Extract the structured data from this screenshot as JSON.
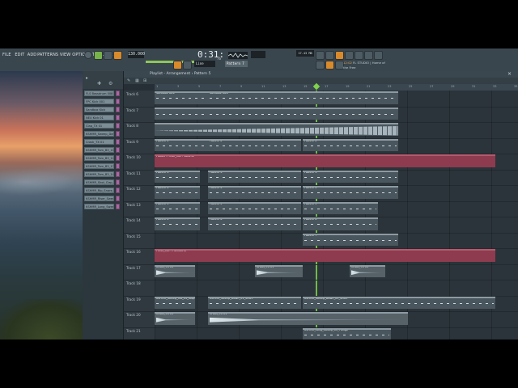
{
  "menu": [
    "FILE",
    "EDIT",
    "ADD",
    "PATTERNS",
    "VIEW",
    "OPTIONS",
    "TOOLS",
    "HELP"
  ],
  "transport": {
    "tempo": "130.000",
    "time": "0:31:",
    "time_small": "76",
    "pattern": "Pattern 7",
    "snap": "Line",
    "cpu": "17.43 MB"
  },
  "hint": {
    "line1": "12:02",
    "line2": "FL STUDIO | Home of",
    "line3": "the Free"
  },
  "playlist": {
    "title": "Playlist - Arrangement › Pattern 5"
  },
  "ruler": [
    "1",
    "3",
    "5",
    "7",
    "9",
    "11",
    "13",
    "15",
    "17",
    "19",
    "21",
    "23",
    "25",
    "27",
    "29",
    "31",
    "33",
    "35"
  ],
  "channels": [
    "FLS Bassdrum 008",
    "FPC Kick 001",
    "Sandbox Kick",
    "NEU Kick 01",
    "Clap_TX 01",
    "KSHMR_Sweep_Down",
    "Crash_TX 01",
    "KSHMR_Tom_B3_11",
    "KSHMR_Tom_B3_12",
    "KSHMR_Tom_B3_13",
    "KSHMR_Tom_B3_14",
    "KSHMR_Shot_Clap_B",
    "KSHMR_Rip_Snare_03",
    "KSHMR_Riser_Sweep",
    "KSHMR_Long_Sweep"
  ],
  "tracks": [
    "Track 6",
    "Track 7",
    "Track 8",
    "Track 9",
    "Track 10",
    "Track 11",
    "Track 12",
    "Track 13",
    "Track 14",
    "Track 15",
    "Track 16",
    "Track 17",
    "Track 18",
    "Track 19",
    "Track 20",
    "Track 21"
  ],
  "clips": [
    {
      "track": 0,
      "start": 0,
      "len": 66,
      "title": "Sandbox Kick",
      "kind": "pattern"
    },
    {
      "track": 0,
      "start": 66,
      "len": 235,
      "title": "Sandbox Kick",
      "kind": "pattern"
    },
    {
      "track": 1,
      "start": 0,
      "len": 66,
      "title": "",
      "kind": "pattern"
    },
    {
      "track": 1,
      "start": 66,
      "len": 235,
      "title": "",
      "kind": "pattern"
    },
    {
      "track": 2,
      "start": 0,
      "len": 301,
      "title": "",
      "kind": "beats"
    },
    {
      "track": 3,
      "start": 0,
      "len": 66,
      "title": "Pattern 2",
      "kind": "pattern"
    },
    {
      "track": 3,
      "start": 66,
      "len": 115,
      "title": "Pattern 2",
      "kind": "pattern"
    },
    {
      "track": 3,
      "start": 183,
      "len": 118,
      "title": "Pattern 2",
      "kind": "pattern"
    },
    {
      "track": 4,
      "start": 0,
      "len": 421,
      "title": "Fusion - Fresh_Cut - Volume",
      "kind": "auto"
    },
    {
      "track": 5,
      "start": 0,
      "len": 56,
      "title": "Pattern 3",
      "kind": "pattern"
    },
    {
      "track": 5,
      "start": 66,
      "len": 115,
      "title": "Pattern 3",
      "kind": "pattern"
    },
    {
      "track": 5,
      "start": 183,
      "len": 118,
      "title": "Pattern 3",
      "kind": "pattern"
    },
    {
      "track": 6,
      "start": 0,
      "len": 56,
      "title": "Pattern 4",
      "kind": "pattern"
    },
    {
      "track": 6,
      "start": 66,
      "len": 115,
      "title": "Pattern 4",
      "kind": "pattern"
    },
    {
      "track": 6,
      "start": 183,
      "len": 118,
      "title": "Pattern 4",
      "kind": "pattern"
    },
    {
      "track": 7,
      "start": 0,
      "len": 56,
      "title": "Pattern 5",
      "kind": "pattern"
    },
    {
      "track": 7,
      "start": 66,
      "len": 115,
      "title": "Pattern 5",
      "kind": "pattern"
    },
    {
      "track": 7,
      "start": 183,
      "len": 93,
      "title": "Pattern 5",
      "kind": "pattern"
    },
    {
      "track": 8,
      "start": 0,
      "len": 56,
      "title": "Pattern 6",
      "kind": "pattern"
    },
    {
      "track": 8,
      "start": 66,
      "len": 115,
      "title": "Pattern 6",
      "kind": "pattern"
    },
    {
      "track": 8,
      "start": 183,
      "len": 93,
      "title": "Pattern 6",
      "kind": "pattern"
    },
    {
      "track": 9,
      "start": 183,
      "len": 118,
      "title": "Pattern 7",
      "kind": "pattern"
    },
    {
      "track": 10,
      "start": 0,
      "len": 421,
      "title": "Fresh_Cut - Pitchbend",
      "kind": "auto"
    },
    {
      "track": 11,
      "start": 0,
      "len": 50,
      "title": "Crash_TX 01",
      "kind": "audio"
    },
    {
      "track": 11,
      "start": 124,
      "len": 59,
      "title": "Crash_TX 01",
      "kind": "audio"
    },
    {
      "track": 11,
      "start": 241,
      "len": 44,
      "title": "Crash_TX 01",
      "kind": "audio"
    },
    {
      "track": 13,
      "start": 0,
      "len": 50,
      "title": "KSHMR_Sweep_Ind_01_Stop",
      "kind": "pattern"
    },
    {
      "track": 13,
      "start": 66,
      "len": 115,
      "title": "KSHMR_Sweep_Down_01_Short",
      "kind": "pattern"
    },
    {
      "track": 13,
      "start": 183,
      "len": 238,
      "title": "KSHMR_Sweep_Down_01_Short",
      "kind": "pattern"
    },
    {
      "track": 14,
      "start": 0,
      "len": 50,
      "title": "Crash_TX 01",
      "kind": "audio"
    },
    {
      "track": 14,
      "start": 66,
      "len": 247,
      "title": "Crash_TX 01",
      "kind": "audio"
    },
    {
      "track": 15,
      "start": 183,
      "len": 109,
      "title": "KSHMR_Long_Sweep_01_Flange",
      "kind": "pattern"
    }
  ],
  "playhead_bar": 16.3,
  "colors": {
    "accent": "#d98a2b",
    "playhead": "#7fd24a",
    "automation": "#8e3b4f"
  }
}
